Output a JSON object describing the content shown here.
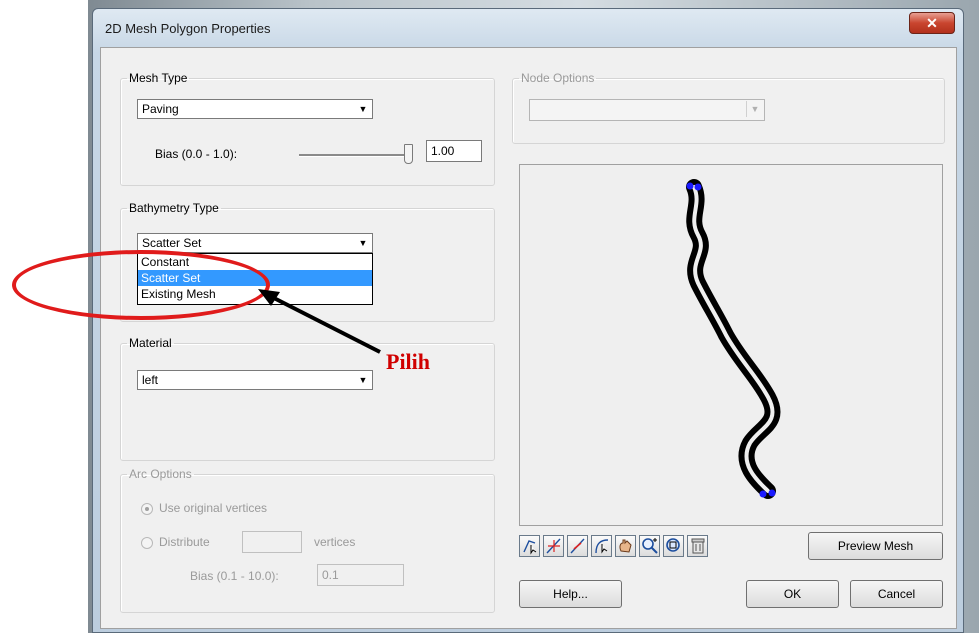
{
  "window": {
    "title": "2D Mesh Polygon Properties",
    "close_glyph": "✕"
  },
  "mesh_type": {
    "legend": "Mesh Type",
    "selected": "Paving",
    "bias_label": "Bias (0.0 - 1.0):",
    "bias_value": "1.00",
    "bias_slider_fraction": 1.0
  },
  "bathymetry": {
    "legend": "Bathymetry Type",
    "selected": "Scatter Set",
    "options": [
      "Constant",
      "Scatter Set",
      "Existing Mesh"
    ]
  },
  "material": {
    "legend": "Material",
    "selected": "left"
  },
  "arc_options": {
    "legend": "Arc Options",
    "radio_original": "Use original vertices",
    "radio_distribute": "Distribute",
    "vertices_label": "vertices",
    "distribute_count": "",
    "bias_label": "Bias (0.1 - 10.0):",
    "bias_value": "0.1"
  },
  "node_options": {
    "legend": "Node Options",
    "selected": ""
  },
  "toolbar": {
    "icons": [
      "select-arc-icon",
      "select-vertex-icon",
      "create-vertex-icon",
      "redistribute-icon",
      "pan-icon",
      "zoom-icon",
      "frame-icon",
      "delete-icon"
    ]
  },
  "buttons": {
    "preview_mesh": "Preview Mesh",
    "help": "Help...",
    "ok": "OK",
    "cancel": "Cancel"
  },
  "annotation": {
    "text": "Pilih",
    "color": "#d00000"
  },
  "colors": {
    "selection": "#3399ff",
    "annotation_ellipse": "#e01b1b",
    "node_dot": "#1a1aff"
  }
}
